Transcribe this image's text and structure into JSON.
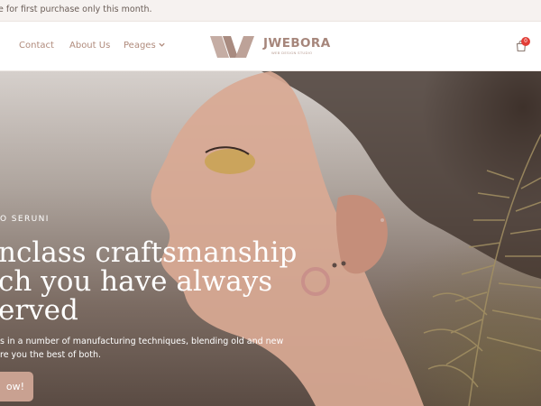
{
  "announcement": {
    "text": "e for first purchase only this month."
  },
  "nav": {
    "links": [
      {
        "label": "Contact"
      },
      {
        "label": "About Us"
      },
      {
        "label": "Peages"
      }
    ]
  },
  "logo": {
    "name": "JWEBORA",
    "tagline": "WEB DESIGN STUDIO"
  },
  "cart": {
    "count": "0"
  },
  "hero": {
    "eyebrow": "O SERUNI",
    "headline": [
      "nclass craftsmanship",
      "ch you have always",
      "erved"
    ],
    "description": [
      "s in a number of manufacturing techniques, blending old and new",
      "re you the best of both."
    ],
    "cta_label": "ow!"
  },
  "colors": {
    "accent": "#c9a191",
    "nav_text": "#b08b7c",
    "badge": "#e23d36"
  },
  "icons": [
    "chevron-down-icon",
    "cart-icon",
    "logo-mark-icon"
  ]
}
